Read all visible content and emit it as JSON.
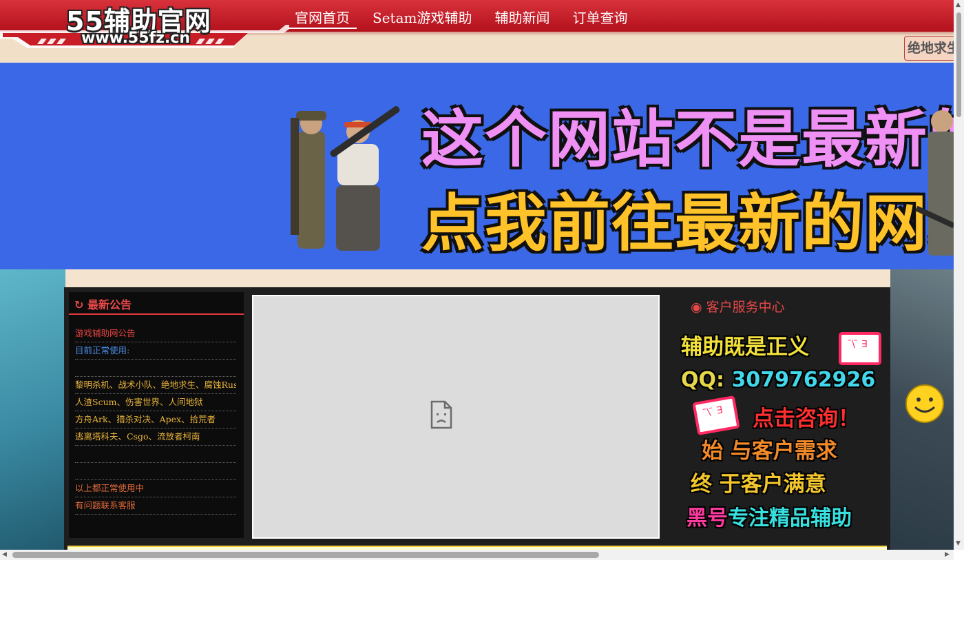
{
  "header": {
    "logo_title": "55辅助官网",
    "logo_url": "www.55fz.cn",
    "nav": [
      {
        "label": "官网首页"
      },
      {
        "label": "Setam游戏辅助"
      },
      {
        "label": "辅助新闻"
      },
      {
        "label": "订单查询"
      }
    ],
    "side_badge": "绝地求生"
  },
  "banner": {
    "line1": "这个网站不是最新的",
    "line2": "点我前往最新的网站"
  },
  "notice": {
    "icon": "refresh-icon",
    "title": "最新公告",
    "lines": [
      {
        "text": "游戏辅助网公告",
        "color": "#e04141"
      },
      {
        "text": "目前正常使用:",
        "color": "#4a8ee8"
      },
      {
        "text": "",
        "color": "#e9b33b"
      },
      {
        "text": "黎明杀机、战术小队、绝地求生、腐蚀Rust",
        "color": "#e9b33b"
      },
      {
        "text": "人渣Scum、伤害世界、人间地狱",
        "color": "#e9b33b"
      },
      {
        "text": "方舟Ark、猎杀对决、Apex、拾荒者",
        "color": "#e9b33b"
      },
      {
        "text": "逃离塔科夫、Csgo、流放者柯南",
        "color": "#e9b33b"
      },
      {
        "text": "",
        "color": "#e9b33b"
      },
      {
        "text": "",
        "color": "#e9b33b"
      },
      {
        "text": "以上都正常使用中",
        "color": "#e06a3a"
      },
      {
        "text": "有问题联系客服",
        "color": "#e06a3a"
      }
    ]
  },
  "video": {
    "icon": "broken-file-icon"
  },
  "service": {
    "icon": "user-circle-icon",
    "title": "客户服务中心",
    "line1": "辅助既是正义",
    "qq_label": "QQ:",
    "qq_number": "3079762926",
    "line3": "点击咨询！",
    "line4": "始 与客户需求",
    "line5": "终 于客户满意",
    "line6_prefix": "黑号",
    "line6_rest": "专注精品辅助"
  },
  "colors": {
    "header_red": "#c41f28",
    "banner_blue": "#3a68e6",
    "accent_red": "#e23a3a"
  }
}
